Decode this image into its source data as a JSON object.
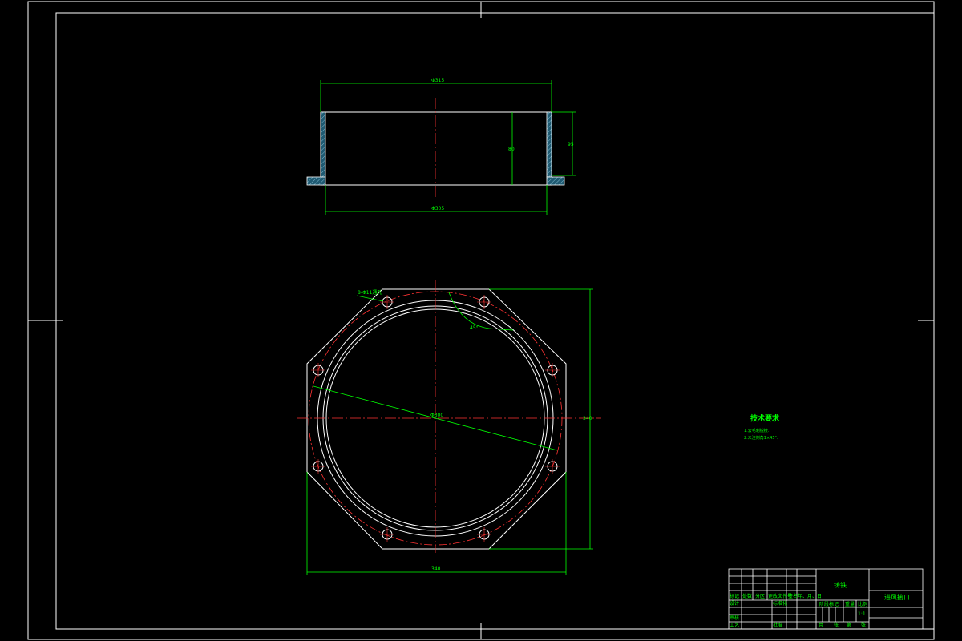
{
  "front_view": {
    "top_dim": "Φ315",
    "bottom_dim": "Φ305",
    "height_dim_left": "80",
    "height_dim_right": "95"
  },
  "plan_view": {
    "hole_note": "8-Φ11通孔",
    "angle_dim": "45°",
    "diameter_dim": "Φ300",
    "height_dim": "340",
    "width_dim": "340"
  },
  "tech_notes": {
    "title": "技术要求",
    "lines": [
      "1.去毛刺锐棱.",
      "2.未注倒角1×45°."
    ]
  },
  "title_block": {
    "material": "铸铁",
    "part_name": "进风接口",
    "header_labels": [
      "标记",
      "处数",
      "分区",
      "更改文件号",
      "签名",
      "年、月、日"
    ],
    "design_label": "设计",
    "standard_label": "标准化",
    "review_label": "审核",
    "process_label": "工艺",
    "approve_label": "批准",
    "stage_label": "阶段标记",
    "weight_label": "重量",
    "scale_label": "比例",
    "scale_value": "1:1",
    "sheet_labels": [
      "共",
      "张",
      "第",
      "张"
    ]
  }
}
